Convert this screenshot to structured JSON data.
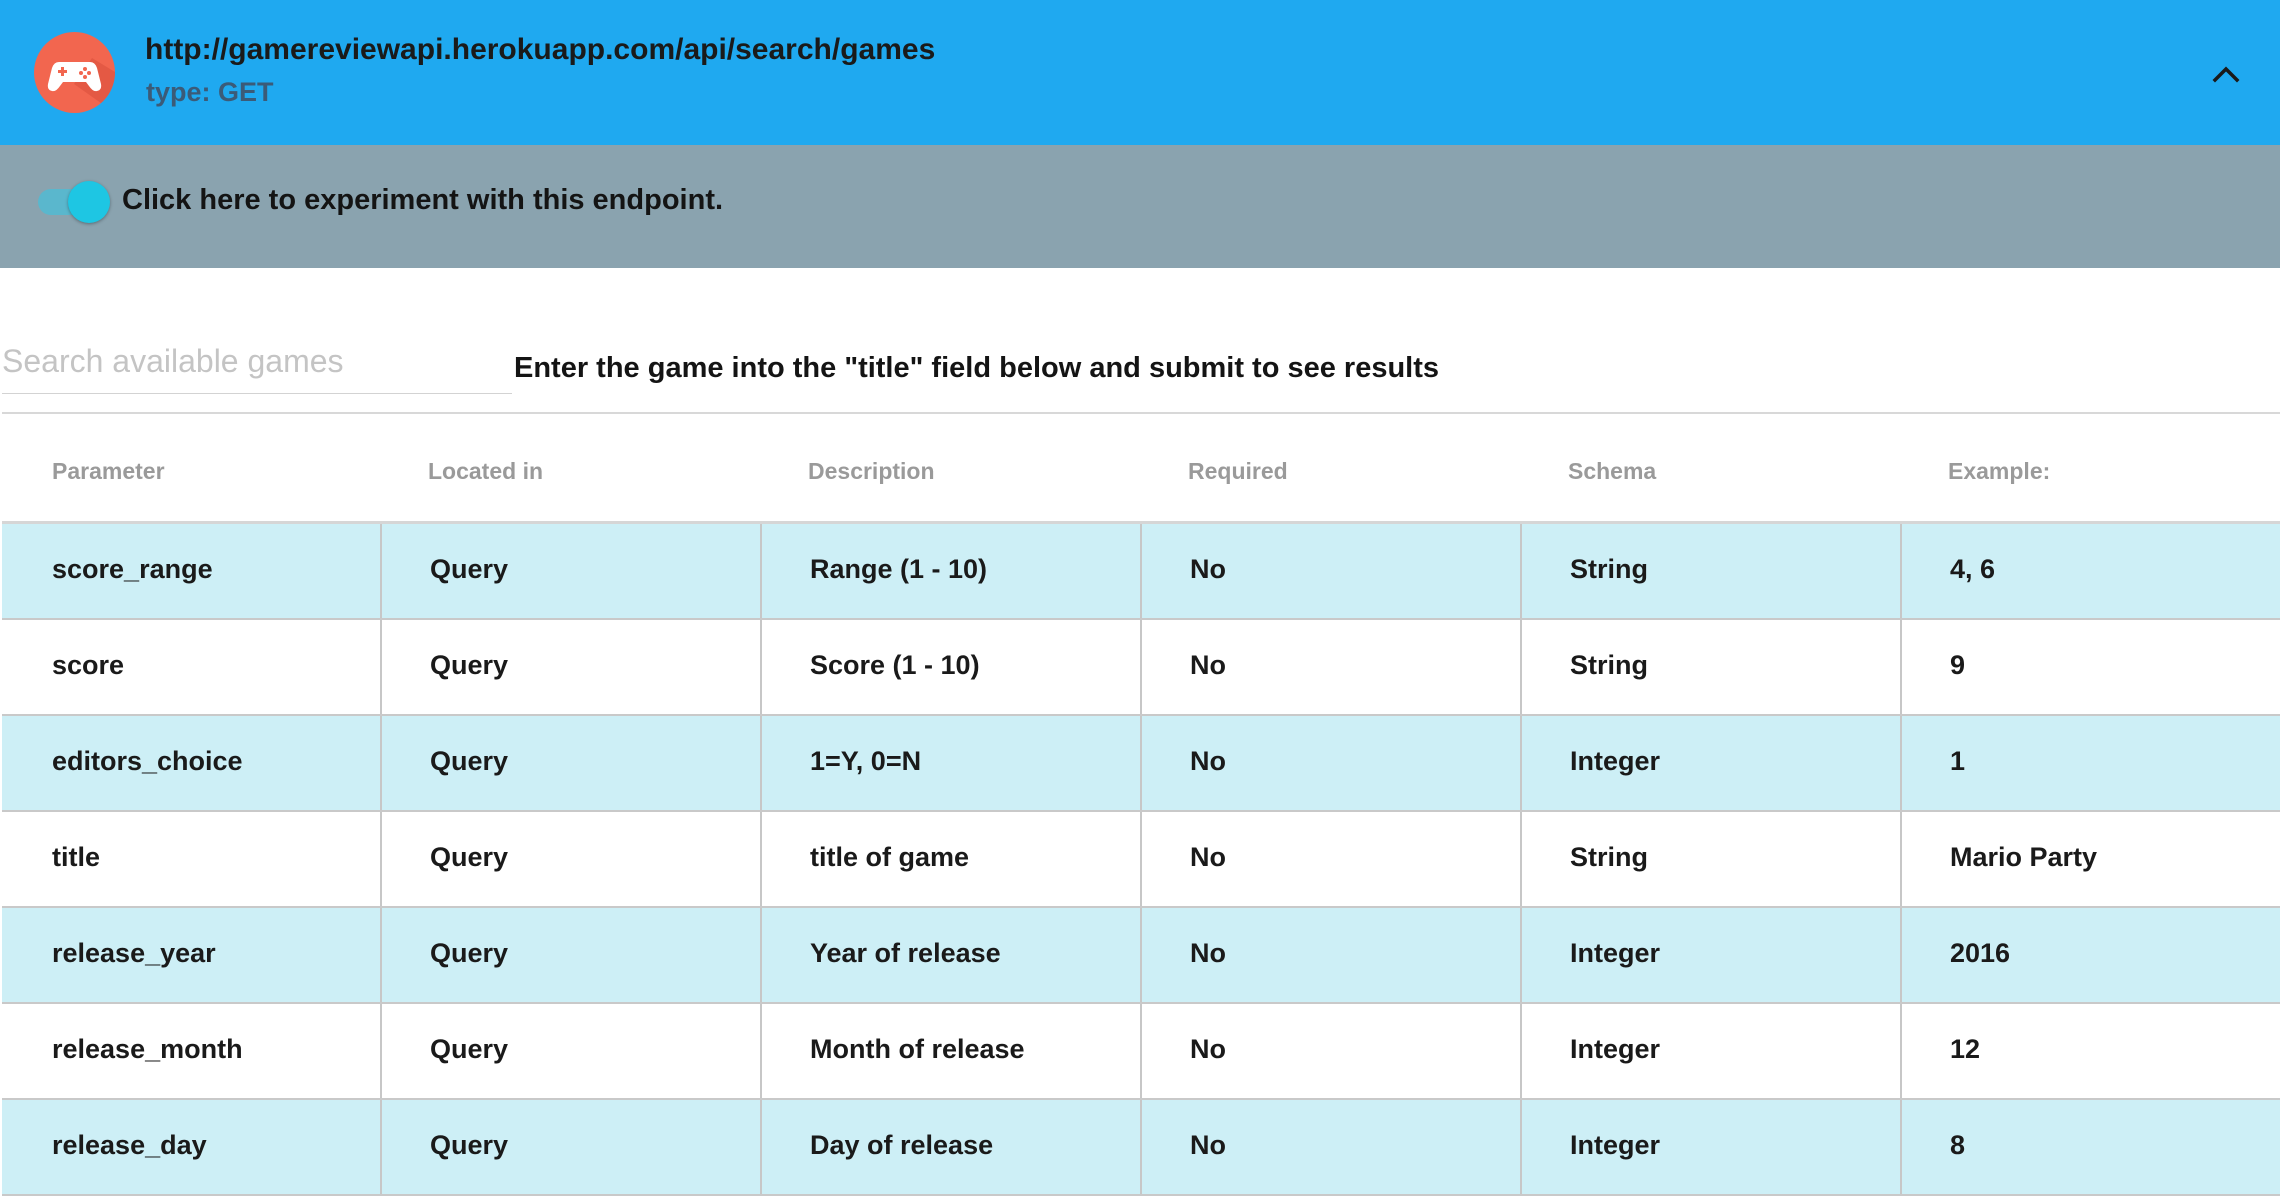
{
  "endpoint": {
    "url": "http://gamereviewapi.herokuapp.com/api/search/games",
    "type_label": "type: GET",
    "icon": "gamepad-icon",
    "collapse_icon": "chevron-up-icon"
  },
  "experiment": {
    "label": "Click here to experiment with this endpoint.",
    "enabled": true
  },
  "search": {
    "placeholder": "Search available games",
    "value": "",
    "hint": "Enter the game into the \"title\" field below and submit to see results"
  },
  "table": {
    "headers": [
      "Parameter",
      "Located in",
      "Description",
      "Required",
      "Schema",
      "Example:"
    ],
    "rows": [
      [
        "score_range",
        "Query",
        "Range (1 - 10)",
        "No",
        "String",
        "4, 6"
      ],
      [
        "score",
        "Query",
        "Score (1 - 10)",
        "No",
        "String",
        "9"
      ],
      [
        "editors_choice",
        "Query",
        "1=Y, 0=N",
        "No",
        "Integer",
        "1"
      ],
      [
        "title",
        "Query",
        "title of game",
        "No",
        "String",
        "Mario Party"
      ],
      [
        "release_year",
        "Query",
        "Year of release",
        "No",
        "Integer",
        "2016"
      ],
      [
        "release_month",
        "Query",
        "Month of release",
        "No",
        "Integer",
        "12"
      ],
      [
        "release_day",
        "Query",
        "Day of release",
        "No",
        "Integer",
        "8"
      ]
    ]
  },
  "colors": {
    "header_bg": "#1fa9f0",
    "toggle_bar_bg": "#8aa3af",
    "row_shaded_bg": "#cdeff6",
    "avatar_bg": "#f2664f",
    "switch_on": "#1ec6e3"
  }
}
